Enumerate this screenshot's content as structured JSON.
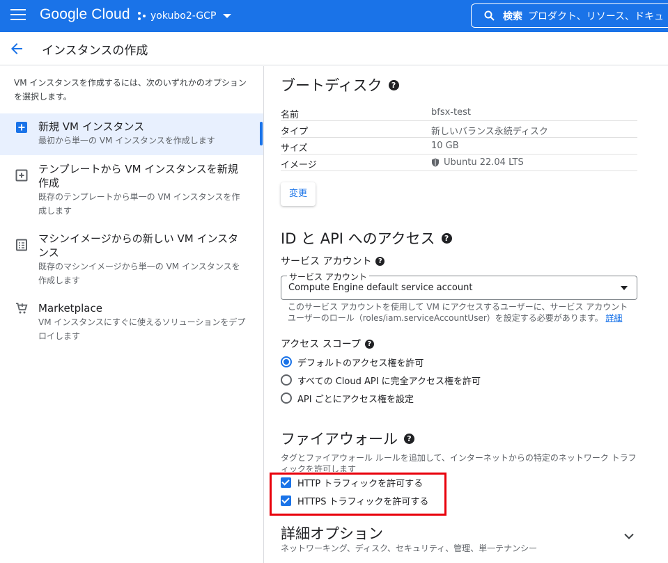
{
  "topbar": {
    "logo": "Google Cloud",
    "project": "yokubo2-GCP",
    "search_keyword": "検索",
    "search_placeholder": "プロダクト、リソース、ドキュ"
  },
  "header": {
    "title": "インスタンスの作成"
  },
  "left": {
    "intro": "VM インスタンスを作成するには、次のいずれかのオプションを選択します。",
    "options": [
      {
        "title": "新規 VM インスタンス",
        "desc": "最初から単一の VM インスタンスを作成します",
        "icon": "add-box-icon",
        "active": true
      },
      {
        "title": "テンプレートから VM インスタンスを新規作成",
        "desc": "既存のテンプレートから単一の VM インスタンスを作成します",
        "icon": "template-icon",
        "active": false
      },
      {
        "title": "マシンイメージからの新しい VM インスタンス",
        "desc": "既存のマシンイメージから単一の VM インスタンスを作成します",
        "icon": "machine-image-icon",
        "active": false
      },
      {
        "title": "Marketplace",
        "desc": "VM インスタンスにすぐに使えるソリューションをデプロイします",
        "icon": "cart-icon",
        "active": false
      }
    ]
  },
  "boot_disk": {
    "title": "ブートディスク",
    "rows": [
      {
        "key": "名前",
        "value": "bfsx-test"
      },
      {
        "key": "タイプ",
        "value": "新しいバランス永続ディスク"
      },
      {
        "key": "サイズ",
        "value": "10 GB"
      },
      {
        "key": "イメージ",
        "value": "Ubuntu 22.04 LTS"
      }
    ],
    "change_label": "変更"
  },
  "access": {
    "title": "ID と API へのアクセス",
    "service_account_label": "サービス アカウント",
    "select_float_label": "サービス アカウント",
    "select_value": "Compute Engine default service account",
    "hint": "このサービス アカウントを使用して VM にアクセスするユーザーに、サービス アカウント ユーザーのロール（roles/iam.serviceAccountUser）を設定する必要があります。",
    "hint_link": "詳細",
    "scope_label": "アクセス スコープ",
    "scopes": [
      {
        "label": "デフォルトのアクセス権を許可",
        "checked": true
      },
      {
        "label": "すべての Cloud API に完全アクセス権を許可",
        "checked": false
      },
      {
        "label": "API ごとにアクセス権を設定",
        "checked": false
      }
    ]
  },
  "firewall": {
    "title": "ファイアウォール",
    "desc": "タグとファイアウォール ルールを追加して、インターネットからの特定のネットワーク トラフィックを許可します",
    "checks": [
      {
        "label": "HTTP トラフィックを許可する",
        "checked": true
      },
      {
        "label": "HTTPS トラフィックを許可する",
        "checked": true
      }
    ]
  },
  "advanced": {
    "title": "詳細オプション",
    "subtitle": "ネットワーキング、ディスク、セキュリティ、管理、単一テナンシー"
  },
  "colors": {
    "brand": "#1a73e8",
    "highlight_box": "#e8000b",
    "active_bg": "#e8f0fe"
  }
}
